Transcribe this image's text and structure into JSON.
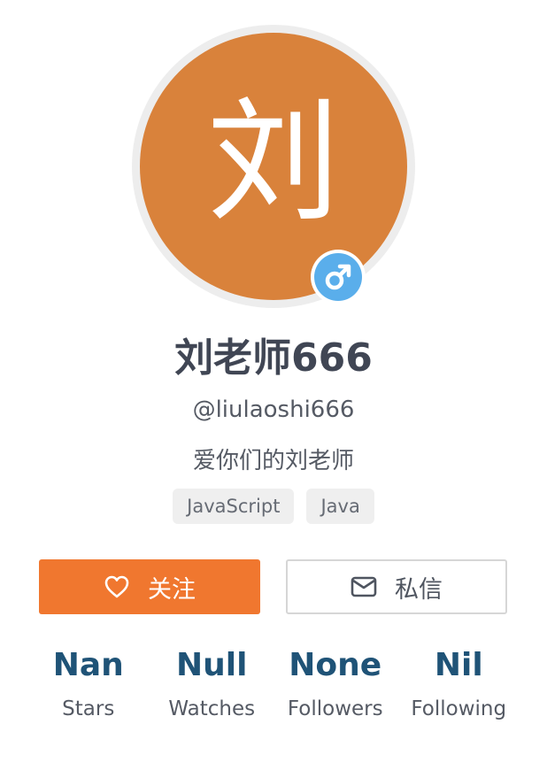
{
  "profile": {
    "avatar_char": "刘",
    "avatar_color": "#d9823b",
    "gender_icon": "male-icon",
    "gender_badge_color": "#5aaeeb",
    "display_name": "刘老师666",
    "username": "@liulaoshi666",
    "bio": "爱你们的刘老师",
    "tags": [
      "JavaScript",
      "Java"
    ]
  },
  "actions": {
    "follow_label": "关注",
    "follow_icon": "heart-icon",
    "follow_color": "#f0772f",
    "message_label": "私信",
    "message_icon": "envelope-icon"
  },
  "stats": [
    {
      "value": "Nan",
      "label": "Stars"
    },
    {
      "value": "Null",
      "label": "Watches"
    },
    {
      "value": "None",
      "label": "Followers"
    },
    {
      "value": "Nil",
      "label": "Following"
    }
  ]
}
